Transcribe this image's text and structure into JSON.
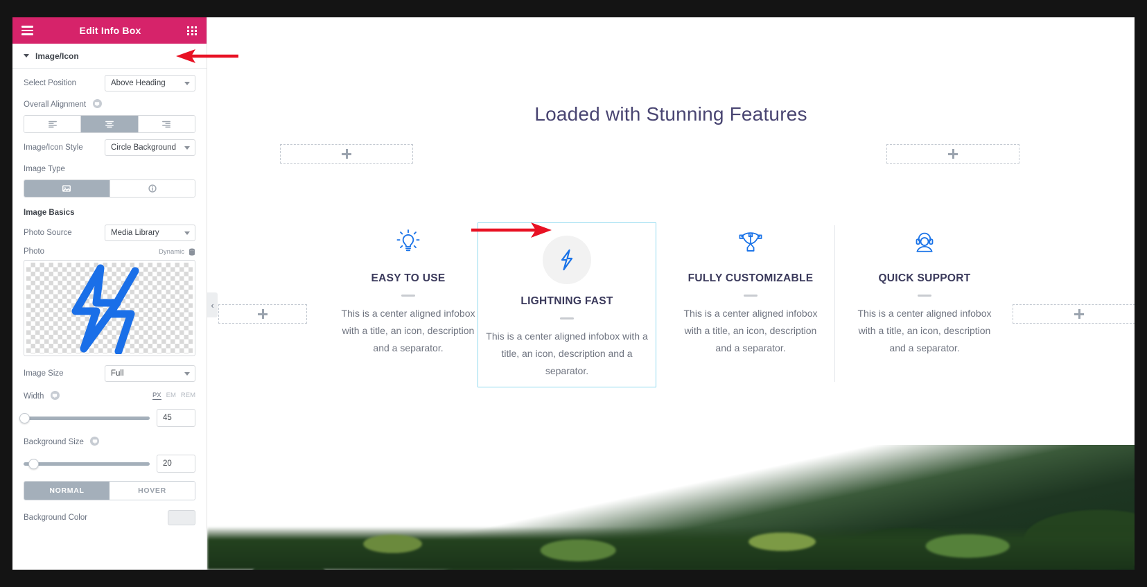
{
  "panel": {
    "header": {
      "title": "Edit Info Box",
      "menu_icon": "hamburger-icon",
      "apps_icon": "grid-apps-icon"
    },
    "section": {
      "title": "Image/Icon"
    },
    "controls": {
      "select_position_label": "Select Position",
      "select_position_value": "Above Heading",
      "overall_alignment_label": "Overall Alignment",
      "alignment_options": [
        "align-left",
        "align-center",
        "align-right"
      ],
      "alignment_selected": "align-center",
      "image_icon_style_label": "Image/Icon Style",
      "image_icon_style_value": "Circle Background",
      "image_type_label": "Image Type",
      "image_type_options": [
        "image",
        "icon"
      ],
      "image_type_selected": "image",
      "image_basics_label": "Image Basics",
      "photo_source_label": "Photo Source",
      "photo_source_value": "Media Library",
      "photo_label": "Photo",
      "dynamic_label": "Dynamic",
      "image_size_label": "Image Size",
      "image_size_value": "Full",
      "width_label": "Width",
      "width_value": "45",
      "units": [
        "PX",
        "EM",
        "REM"
      ],
      "unit_selected": "PX",
      "background_size_label": "Background Size",
      "background_size_value": "20",
      "state_tabs": [
        "NORMAL",
        "HOVER"
      ],
      "state_selected": "NORMAL",
      "background_color_label": "Background Color"
    },
    "accent_color": "#d6236a"
  },
  "canvas": {
    "heading": "Loaded with Stunning Features",
    "heading_color": "#494572",
    "selected_border_color": "#8fd9ef",
    "icon_color": "#1a73e8",
    "collapse_handle": "‹",
    "add_boxes": [
      {
        "name": "add-section-top-left"
      },
      {
        "name": "add-section-top-right"
      },
      {
        "name": "add-section-mid-left"
      },
      {
        "name": "add-section-mid-right"
      }
    ],
    "cards": [
      {
        "icon": "lightbulb-icon",
        "title": "EASY TO USE",
        "description": "This is a center aligned infobox with a title, an icon, description and a separator.",
        "selected": false,
        "circle_background": false
      },
      {
        "icon": "lightning-bolt-icon",
        "title": "LIGHTNING FAST",
        "description": "This is a center aligned infobox with a title, an icon, description and a separator.",
        "selected": true,
        "circle_background": true
      },
      {
        "icon": "pen-tool-icon",
        "title": "FULLY CUSTOMIZABLE",
        "description": "This is a center aligned infobox with a title, an icon, description and a separator.",
        "selected": false,
        "circle_background": false
      },
      {
        "icon": "headset-support-icon",
        "title": "QUICK SUPPORT",
        "description": "This is a center aligned infobox with a title, an icon, description and a separator.",
        "selected": false,
        "circle_background": false
      }
    ]
  },
  "annotations": {
    "arrow_color": "#e81123",
    "arrows": [
      {
        "name": "arrow-pointing-to-image-icon-section"
      },
      {
        "name": "arrow-pointing-to-lightning-icon"
      }
    ]
  }
}
